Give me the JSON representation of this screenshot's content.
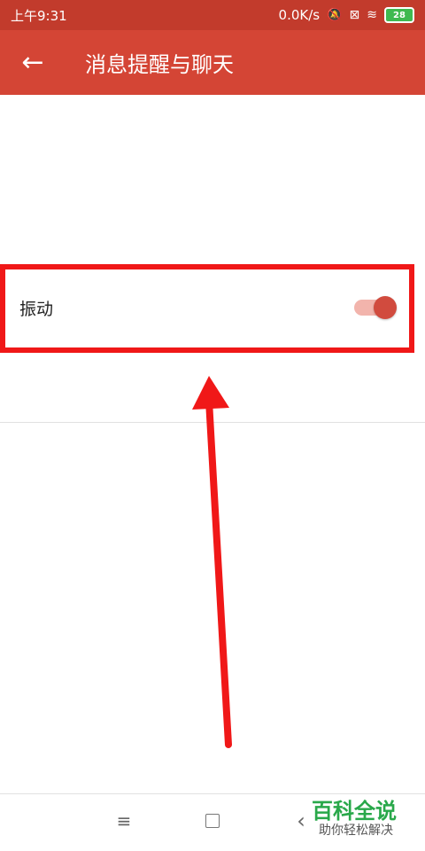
{
  "status_bar": {
    "time": "上午9:31",
    "network_speed": "0.0K/s",
    "icons": [
      "mute-icon",
      "sim-icon",
      "wifi-icon"
    ],
    "battery": "28"
  },
  "app_bar": {
    "back_icon": "arrow-left-icon",
    "title": "消息提醒与聊天"
  },
  "settings": {
    "vibrate_label": "振动",
    "vibrate_enabled": true
  },
  "annotation": {
    "highlight_color": "#f01818"
  },
  "nav_bar": {
    "menu_icon": "menu-icon",
    "home_icon": "home-icon",
    "back_icon": "back-icon"
  },
  "watermark": {
    "title": "百科全说",
    "subtitle": "助你轻松解决"
  },
  "colors": {
    "status_bar": "#c23b2c",
    "app_bar": "#d44535",
    "toggle_track": "#f2b4ac",
    "toggle_thumb": "#d14b3e",
    "watermark_green": "#29a84a"
  }
}
